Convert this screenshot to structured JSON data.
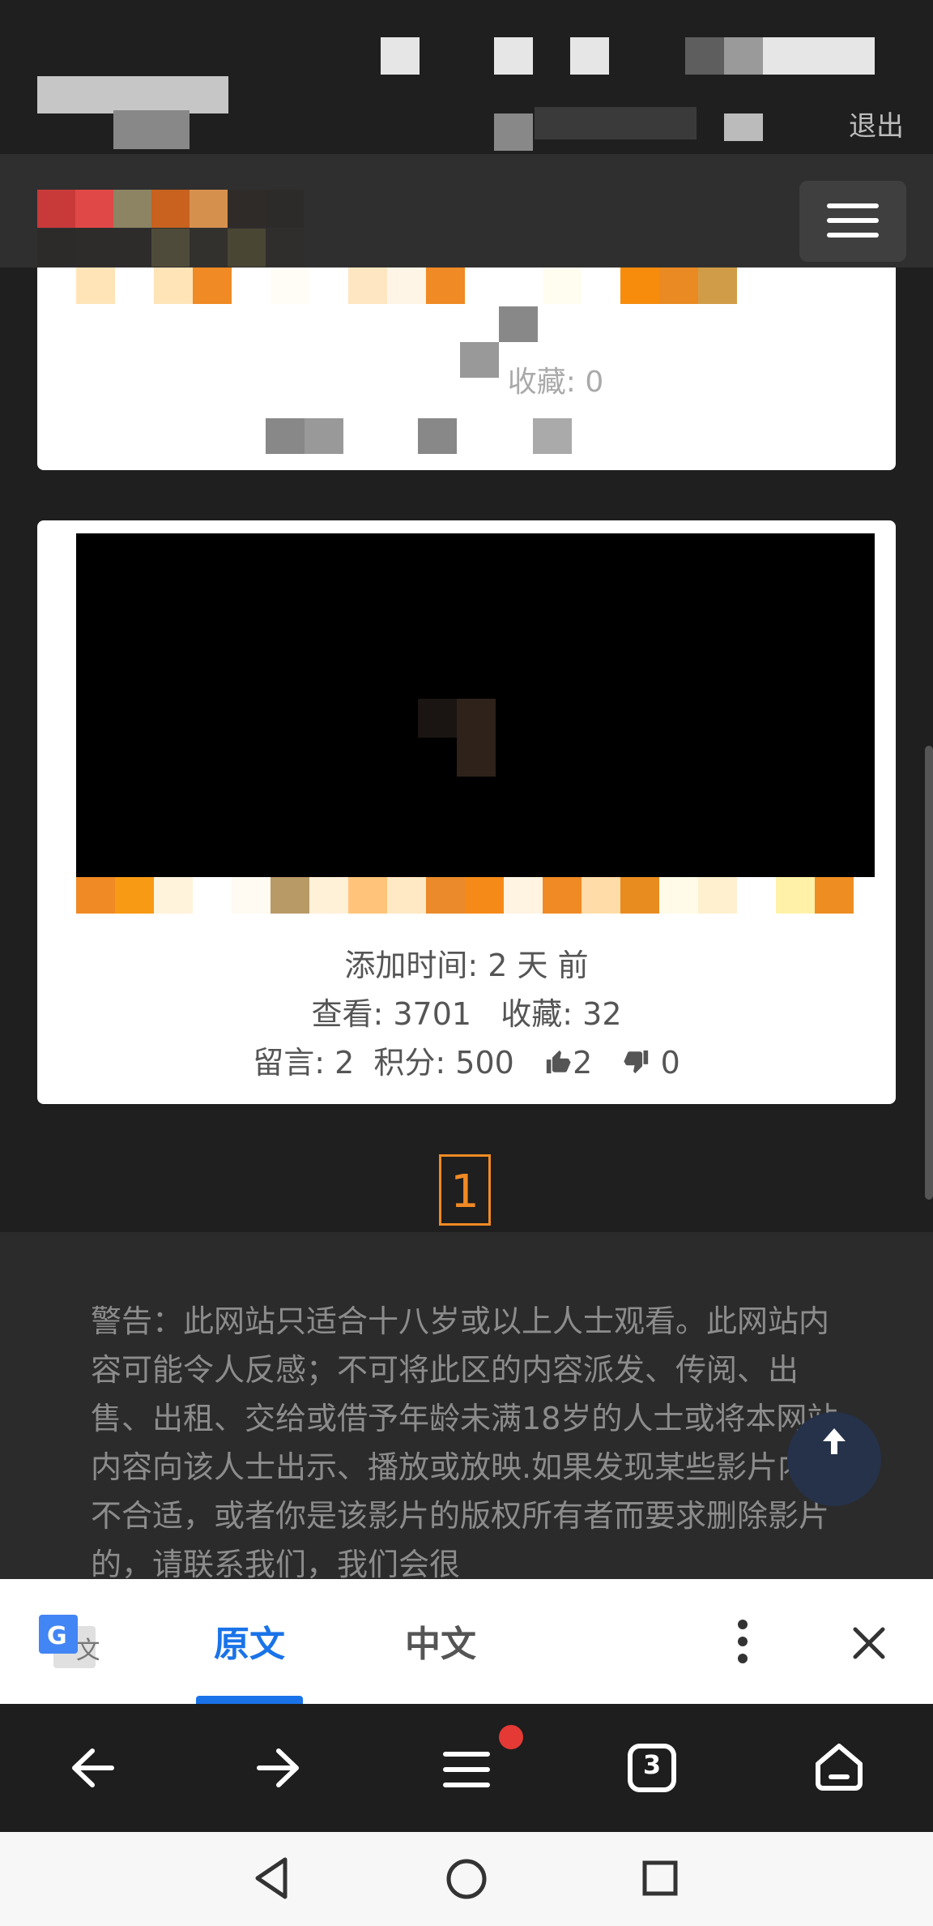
{
  "header": {
    "logout_label": "退出",
    "menu_icon": "hamburger-icon"
  },
  "card2": {
    "added_time": "添加时间: 2 天 前",
    "views_label": "查看: 3701",
    "favorites_label": "收藏: 32",
    "comments_label": "留言: 2",
    "points_label": "积分: 500",
    "likes": "2",
    "dislikes": "0"
  },
  "card1": {
    "favorites_label": "收藏: 0"
  },
  "pagination": {
    "current_page": "1"
  },
  "footer": {
    "warning": "警告：此网站只适合十八岁或以上人士观看。此网站内容可能令人反感；不可将此区的内容派发、传阅、出售、出租、交给或借予年龄未满18岁的人士或将本网站内容向该人士出示、播放或放映.如果发现某些影片内容不合适，或者你是该影片的版权所有者而要求删除影片的，请联系我们，我们会很"
  },
  "translate_bar": {
    "tab_original": "原文",
    "tab_chinese": "中文",
    "translate_icon": "google-translate-icon",
    "more_icon": "more-vertical-icon",
    "close_icon": "close-icon"
  },
  "browser": {
    "tab_count": "3",
    "accent_red": "#e53935"
  },
  "colors": {
    "accent": "#1a73e8",
    "page_accent": "#f08a24"
  }
}
